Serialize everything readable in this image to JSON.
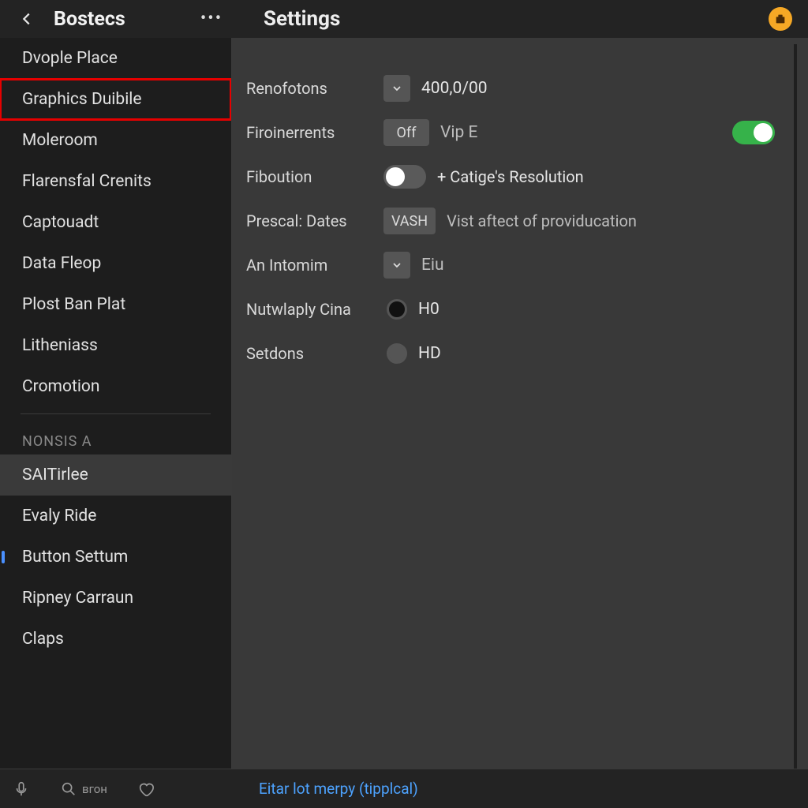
{
  "header": {
    "app_title": "Bostecs",
    "page_title": "Settings"
  },
  "sidebar": {
    "items": [
      {
        "label": "Dvople Place",
        "highlight": false
      },
      {
        "label": "Graphics Duibile",
        "highlight": true
      },
      {
        "label": "Moleroom"
      },
      {
        "label": "Flarensfal Crenits"
      },
      {
        "label": "Captouadt"
      },
      {
        "label": "Data Fleop"
      },
      {
        "label": "Plost Ban Plat"
      },
      {
        "label": "Litheniass"
      },
      {
        "label": "Cromotion"
      }
    ],
    "group_label": "NONSIS A",
    "items2": [
      {
        "label": "SAITirlee",
        "selected": true
      },
      {
        "label": "Evaly Ride"
      },
      {
        "label": "Button Settum",
        "indicator": true
      },
      {
        "label": "Ripney Carraun"
      },
      {
        "label": "Claps"
      }
    ]
  },
  "settings": {
    "rows": [
      {
        "label": "Renofotons",
        "value": "400,0/00"
      },
      {
        "label": "Firoinerrents",
        "pill": "Off",
        "value": "Vip E"
      },
      {
        "label": "Fiboution",
        "extra": "+ Catige's Resolution"
      },
      {
        "label": "Prescal: Dates",
        "pill": "VASH",
        "value": "Vist aftect of providucation"
      },
      {
        "label": "An Intomim",
        "value": "Eiu"
      },
      {
        "label": "Nutwlaply Cina",
        "value": "H0"
      },
      {
        "label": "Setdons",
        "value": "HD"
      }
    ]
  },
  "bottom": {
    "label2": "вгон",
    "link": "Eitar lot merpy (tipplcal)"
  }
}
